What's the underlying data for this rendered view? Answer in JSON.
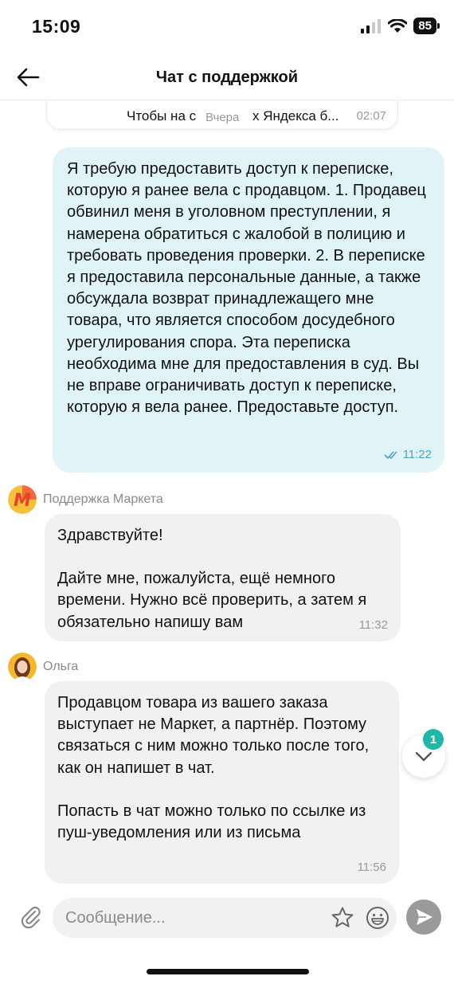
{
  "status_bar": {
    "time": "15:09",
    "battery": "85"
  },
  "header": {
    "title": "Чат с поддержкой"
  },
  "chat": {
    "previous_message": {
      "text": "Чтобы на с",
      "text_tail": "х Яндекса б...",
      "time": "02:07"
    },
    "date_divider": "Вчера",
    "outgoing": {
      "text": "Я требую предоставить доступ к переписке, которую я ранее вела с продавцом. 1. Продавец обвинил меня в уголовном преступлении, я намерена обратиться с жалобой в полицию и требовать проведения проверки. 2. В переписке я предоставила персональные данные, а также обсуждала возврат принадлежащего мне товара, что является способом досудебного урегулирования спора. Эта переписка необходима мне для предоставления в суд. Вы не вправе ограничивать доступ к переписке, которую я вела ранее. Предоставьте доступ.",
      "time": "11:22",
      "status": "read"
    },
    "support": {
      "sender": "Поддержка Маркета",
      "avatar_letter": "М",
      "greeting": "Здравствуйте!",
      "text": "Дайте мне, пожалуйста, ещё немного времени. Нужно всё проверить, а затем я обязательно напишу вам",
      "time": "11:32"
    },
    "operator": {
      "sender": "Ольга",
      "paragraph1": "Продавцом товара из вашего заказа выступает не Маркет, а партнёр. Поэтому связаться с ним можно только после того, как он напишет в чат.",
      "paragraph2": "Попасть в чат можно только по ссылке из пуш-уведомления или из письма",
      "time": "11:56"
    },
    "unread_count": "1"
  },
  "composer": {
    "placeholder": "Сообщение..."
  },
  "colors": {
    "outgoing_bubble": "#e0f3f6",
    "incoming_bubble": "#f1f1f1",
    "brand": "#f4c13b",
    "badge": "#1fb7a6"
  }
}
